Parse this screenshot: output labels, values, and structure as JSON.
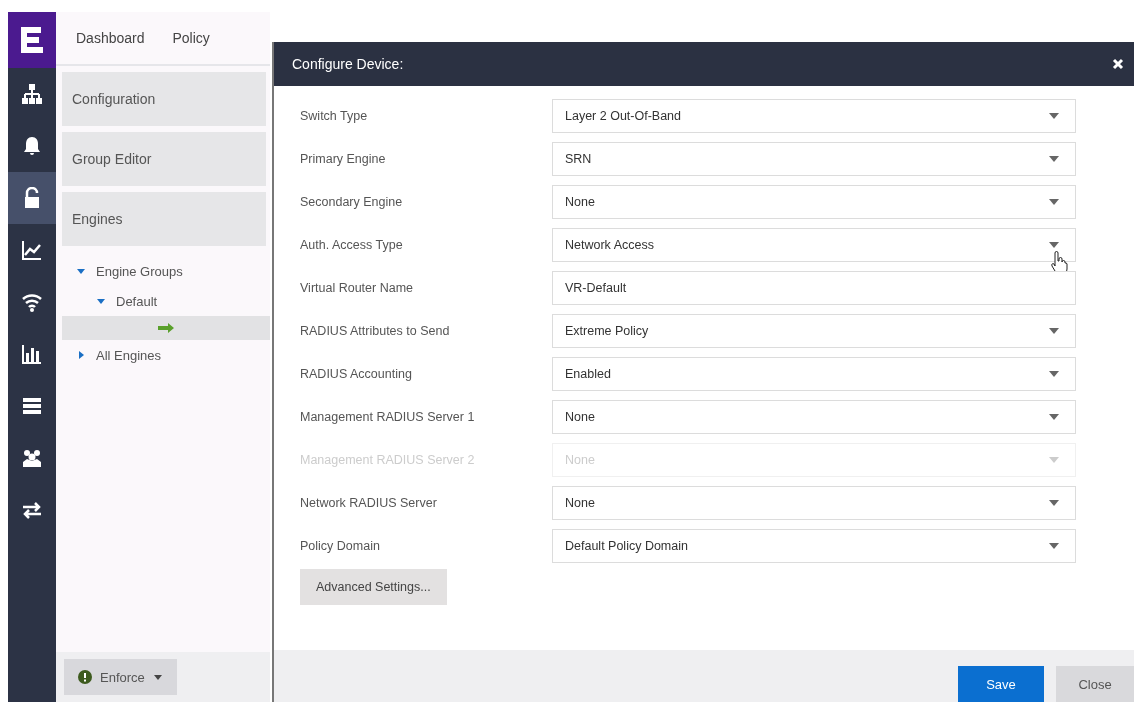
{
  "rail": [
    {
      "kind": "logo",
      "selected": false
    },
    {
      "kind": "network",
      "selected": false
    },
    {
      "kind": "alarms",
      "selected": false
    },
    {
      "kind": "control",
      "selected": true
    },
    {
      "kind": "analytics",
      "selected": false
    },
    {
      "kind": "wireless",
      "selected": false
    },
    {
      "kind": "reports",
      "selected": false
    },
    {
      "kind": "tasks",
      "selected": false
    },
    {
      "kind": "admin",
      "selected": false
    },
    {
      "kind": "connect",
      "selected": false
    }
  ],
  "top_nav": [
    "Dashboard",
    "Policy"
  ],
  "sidebar": {
    "sections": [
      "Configuration",
      "Group Editor",
      "Engines"
    ],
    "tree": [
      {
        "label": "Engine Groups",
        "expanded": true,
        "selected": false,
        "children": [
          {
            "label": "Default",
            "expanded": true,
            "selected": false,
            "children": [
              {
                "kind": "engine",
                "selected": true
              }
            ]
          }
        ]
      },
      {
        "label": "All Engines",
        "expanded": false,
        "selected": false
      }
    ],
    "enforce_button": "Enforce"
  },
  "dialog": {
    "title": "Configure Device:",
    "fields": [
      {
        "label": "Switch Type",
        "value": "Layer 2 Out-Of-Band",
        "kind": "select",
        "disabled": false
      },
      {
        "label": "Primary Engine",
        "value": "SRN",
        "kind": "select",
        "disabled": false
      },
      {
        "label": "Secondary Engine",
        "value": "None",
        "kind": "select",
        "disabled": false
      },
      {
        "label": "Auth. Access Type",
        "value": "Network Access",
        "kind": "select",
        "disabled": false
      },
      {
        "label": "Virtual Router Name",
        "value": "VR-Default",
        "kind": "text",
        "disabled": false
      },
      {
        "label": "RADIUS Attributes to Send",
        "value": "Extreme Policy",
        "kind": "select",
        "disabled": false
      },
      {
        "label": "RADIUS Accounting",
        "value": "Enabled",
        "kind": "select",
        "disabled": false
      },
      {
        "label": "Management RADIUS Server 1",
        "value": "None",
        "kind": "select",
        "disabled": false
      },
      {
        "label": "Management RADIUS Server 2",
        "value": "None",
        "kind": "select",
        "disabled": true
      },
      {
        "label": "Network RADIUS Server",
        "value": "None",
        "kind": "select",
        "disabled": false
      },
      {
        "label": "Policy Domain",
        "value": "Default Policy Domain",
        "kind": "select",
        "disabled": false
      }
    ],
    "advanced_button": "Advanced Settings...",
    "buttons": [
      {
        "label": "Save",
        "kind": "primary"
      },
      {
        "label": "Close",
        "kind": "secondary"
      }
    ]
  }
}
